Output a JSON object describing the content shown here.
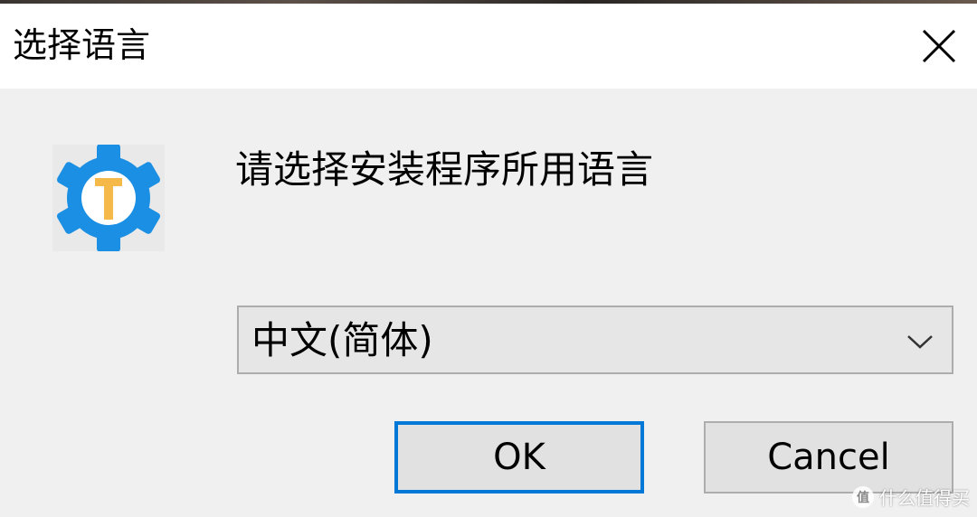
{
  "dialog": {
    "title": "选择语言",
    "prompt": "请选择安装程序所用语言",
    "language_select": {
      "selected": "中文(简体)"
    },
    "buttons": {
      "ok_label": "OK",
      "cancel_label": "Cancel"
    }
  },
  "icons": {
    "close": "close-icon",
    "app": "gear-t-app-icon",
    "dropdown": "chevron-down-icon"
  },
  "colors": {
    "accent": "#0078d7",
    "app_icon_blue": "#1a8fe3",
    "app_icon_letter": "#f5b94a"
  },
  "watermark": {
    "text": "什么值得买"
  }
}
